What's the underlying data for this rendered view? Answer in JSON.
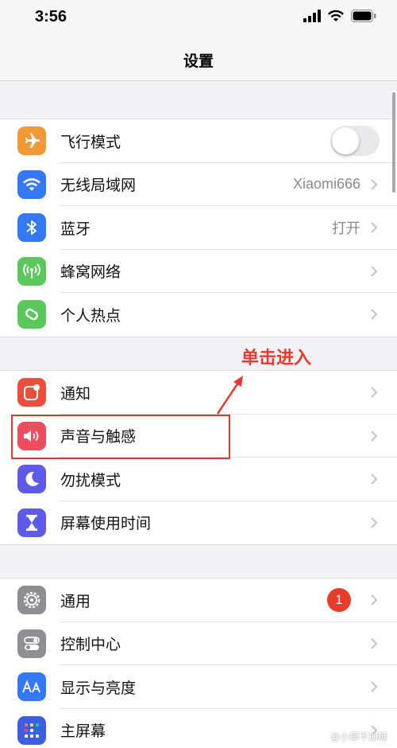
{
  "status": {
    "time": "3:56"
  },
  "nav": {
    "title": "设置"
  },
  "group1": [
    {
      "label": "飞行模式",
      "icon": "airplane-icon",
      "color": "#f09a37",
      "toggle": false
    },
    {
      "label": "无线局域网",
      "icon": "wifi-icon",
      "color": "#3478f6",
      "value": "Xiaomi666"
    },
    {
      "label": "蓝牙",
      "icon": "bluetooth-icon",
      "color": "#3478f6",
      "value": "打开"
    },
    {
      "label": "蜂窝网络",
      "icon": "cellular-icon",
      "color": "#5ac85a"
    },
    {
      "label": "个人热点",
      "icon": "hotspot-icon",
      "color": "#5ac85a"
    }
  ],
  "group2": [
    {
      "label": "通知",
      "icon": "notification-icon",
      "color": "#eb4e3d"
    },
    {
      "label": "声音与触感",
      "icon": "sound-icon",
      "color": "#eb4e5e"
    },
    {
      "label": "勿扰模式",
      "icon": "moon-icon",
      "color": "#5e5ce6"
    },
    {
      "label": "屏幕使用时间",
      "icon": "hourglass-icon",
      "color": "#5e5ce6"
    }
  ],
  "group3": [
    {
      "label": "通用",
      "icon": "gear-icon",
      "color": "#8e8e93",
      "badge": "1"
    },
    {
      "label": "控制中心",
      "icon": "toggles-icon",
      "color": "#8e8e93"
    },
    {
      "label": "显示与亮度",
      "icon": "text-size-icon",
      "color": "#3478f6"
    },
    {
      "label": "主屏幕",
      "icon": "home-grid-icon",
      "color": "#3b5fe0"
    }
  ],
  "annotation": {
    "text": "单击进入"
  },
  "watermark": {
    "text": "@小椰不加糖"
  }
}
